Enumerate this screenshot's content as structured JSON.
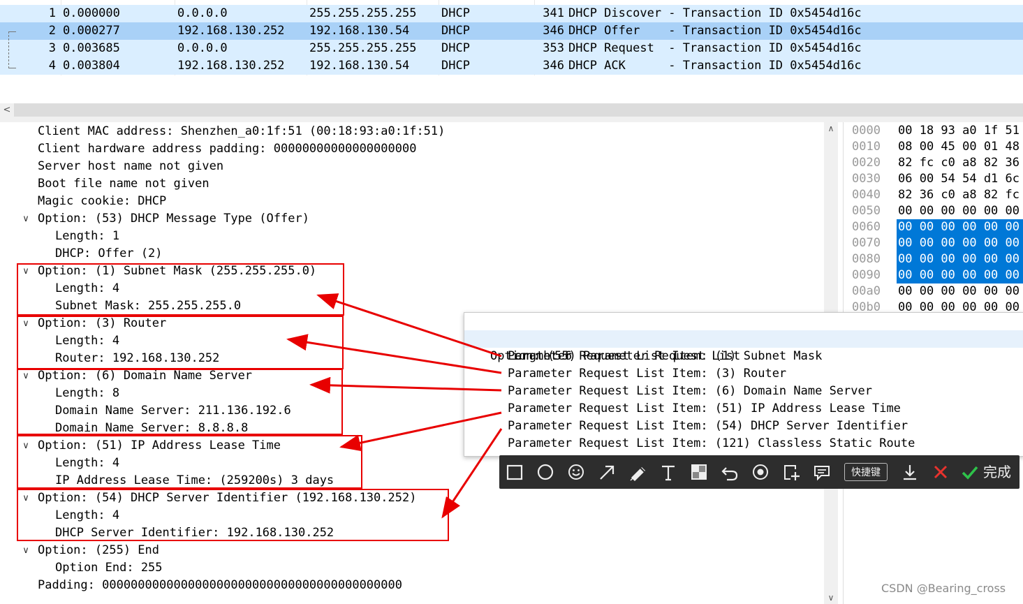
{
  "packets": [
    {
      "no": "1",
      "time": "0.000000",
      "src": "0.0.0.0",
      "dst": "255.255.255.255",
      "proto": "DHCP",
      "len": "341",
      "info": "DHCP Discover - Transaction ID 0x5454d16c"
    },
    {
      "no": "2",
      "time": "0.000277",
      "src": "192.168.130.252",
      "dst": "192.168.130.54",
      "proto": "DHCP",
      "len": "346",
      "info": "DHCP Offer    - Transaction ID 0x5454d16c"
    },
    {
      "no": "3",
      "time": "0.003685",
      "src": "0.0.0.0",
      "dst": "255.255.255.255",
      "proto": "DHCP",
      "len": "353",
      "info": "DHCP Request  - Transaction ID 0x5454d16c"
    },
    {
      "no": "4",
      "time": "0.003804",
      "src": "192.168.130.252",
      "dst": "192.168.130.54",
      "proto": "DHCP",
      "len": "346",
      "info": "DHCP ACK      - Transaction ID 0x5454d16c"
    }
  ],
  "details": {
    "lines": [
      {
        "indent": 0,
        "arrow": "",
        "text": "Client MAC address: Shenzhen_a0:1f:51 (00:18:93:a0:1f:51)"
      },
      {
        "indent": 0,
        "arrow": "",
        "text": "Client hardware address padding: 00000000000000000000"
      },
      {
        "indent": 0,
        "arrow": "",
        "text": "Server host name not given"
      },
      {
        "indent": 0,
        "arrow": "",
        "text": "Boot file name not given"
      },
      {
        "indent": 0,
        "arrow": "",
        "text": "Magic cookie: DHCP"
      },
      {
        "indent": 0,
        "arrow": "v",
        "text": "Option: (53) DHCP Message Type (Offer)"
      },
      {
        "indent": 1,
        "arrow": "",
        "text": "Length: 1"
      },
      {
        "indent": 1,
        "arrow": "",
        "text": "DHCP: Offer (2)"
      },
      {
        "indent": 0,
        "arrow": "v",
        "text": "Option: (1) Subnet Mask (255.255.255.0)"
      },
      {
        "indent": 1,
        "arrow": "",
        "text": "Length: 4"
      },
      {
        "indent": 1,
        "arrow": "",
        "text": "Subnet Mask: 255.255.255.0"
      },
      {
        "indent": 0,
        "arrow": "v",
        "text": "Option: (3) Router"
      },
      {
        "indent": 1,
        "arrow": "",
        "text": "Length: 4"
      },
      {
        "indent": 1,
        "arrow": "",
        "text": "Router: 192.168.130.252"
      },
      {
        "indent": 0,
        "arrow": "v",
        "text": "Option: (6) Domain Name Server"
      },
      {
        "indent": 1,
        "arrow": "",
        "text": "Length: 8"
      },
      {
        "indent": 1,
        "arrow": "",
        "text": "Domain Name Server: 211.136.192.6"
      },
      {
        "indent": 1,
        "arrow": "",
        "text": "Domain Name Server: 8.8.8.8"
      },
      {
        "indent": 0,
        "arrow": "v",
        "text": "Option: (51) IP Address Lease Time"
      },
      {
        "indent": 1,
        "arrow": "",
        "text": "Length: 4"
      },
      {
        "indent": 1,
        "arrow": "",
        "text": "IP Address Lease Time: (259200s) 3 days"
      },
      {
        "indent": 0,
        "arrow": "v",
        "text": "Option: (54) DHCP Server Identifier (192.168.130.252)"
      },
      {
        "indent": 1,
        "arrow": "",
        "text": "Length: 4"
      },
      {
        "indent": 1,
        "arrow": "",
        "text": "DHCP Server Identifier: 192.168.130.252"
      },
      {
        "indent": 0,
        "arrow": "v",
        "text": "Option: (255) End"
      },
      {
        "indent": 1,
        "arrow": "",
        "text": "Option End: 255"
      },
      {
        "indent": 0,
        "arrow": "",
        "text": "Padding: 000000000000000000000000000000000000000000"
      }
    ]
  },
  "bytes": {
    "rows": [
      {
        "offset": "0000",
        "hex": "00 18 93 a0 1f 51",
        "selected": false
      },
      {
        "offset": "0010",
        "hex": "08 00 45 00 01 48",
        "selected": false
      },
      {
        "offset": "0020",
        "hex": "82 fc c0 a8 82 36",
        "selected": false
      },
      {
        "offset": "0030",
        "hex": "06 00 54 54 d1 6c",
        "selected": false
      },
      {
        "offset": "0040",
        "hex": "82 36 c0 a8 82 fc",
        "selected": false
      },
      {
        "offset": "0050",
        "hex": "00 00 00 00 00 00",
        "selected": false
      },
      {
        "offset": "0060",
        "hex": "00 00 00 00 00 00",
        "selected": true
      },
      {
        "offset": "0070",
        "hex": "00 00 00 00 00 00",
        "selected": true
      },
      {
        "offset": "0080",
        "hex": "00 00 00 00 00 00",
        "selected": true
      },
      {
        "offset": "0090",
        "hex": "00 00 00 00 00 00",
        "selected": true
      },
      {
        "offset": "00a0",
        "hex": "00 00 00 00 00 00",
        "selected": false
      },
      {
        "offset": "00b0",
        "hex": "00 00 00 00 00 00",
        "selected": false
      }
    ]
  },
  "popup": {
    "header": "Option: (55) Parameter Request List",
    "length": "Length: 6",
    "items": [
      "Parameter Request List Item: (1) Subnet Mask",
      "Parameter Request List Item: (3) Router",
      "Parameter Request List Item: (6) Domain Name Server",
      "Parameter Request List Item: (51) IP Address Lease Time",
      "Parameter Request List Item: (54) DHCP Server Identifier",
      "Parameter Request List Item: (121) Classless Static Route"
    ]
  },
  "toolbar": {
    "icons": [
      "rectangle-tool-icon",
      "ellipse-tool-icon",
      "emoji-tool-icon",
      "arrow-tool-icon",
      "pen-tool-icon",
      "text-tool-icon",
      "mosaic-tool-icon",
      "undo-icon",
      "record-icon",
      "pin-icon",
      "comment-icon"
    ],
    "shortcut_label": "快捷键",
    "done_label": "完成"
  },
  "watermark": "CSDN @Bearing_cross",
  "colors": {
    "selected_row": "#a9d1f7",
    "normal_row": "#daeeff",
    "highlight_box": "#e80000",
    "bytes_selected": "#0078d7"
  }
}
